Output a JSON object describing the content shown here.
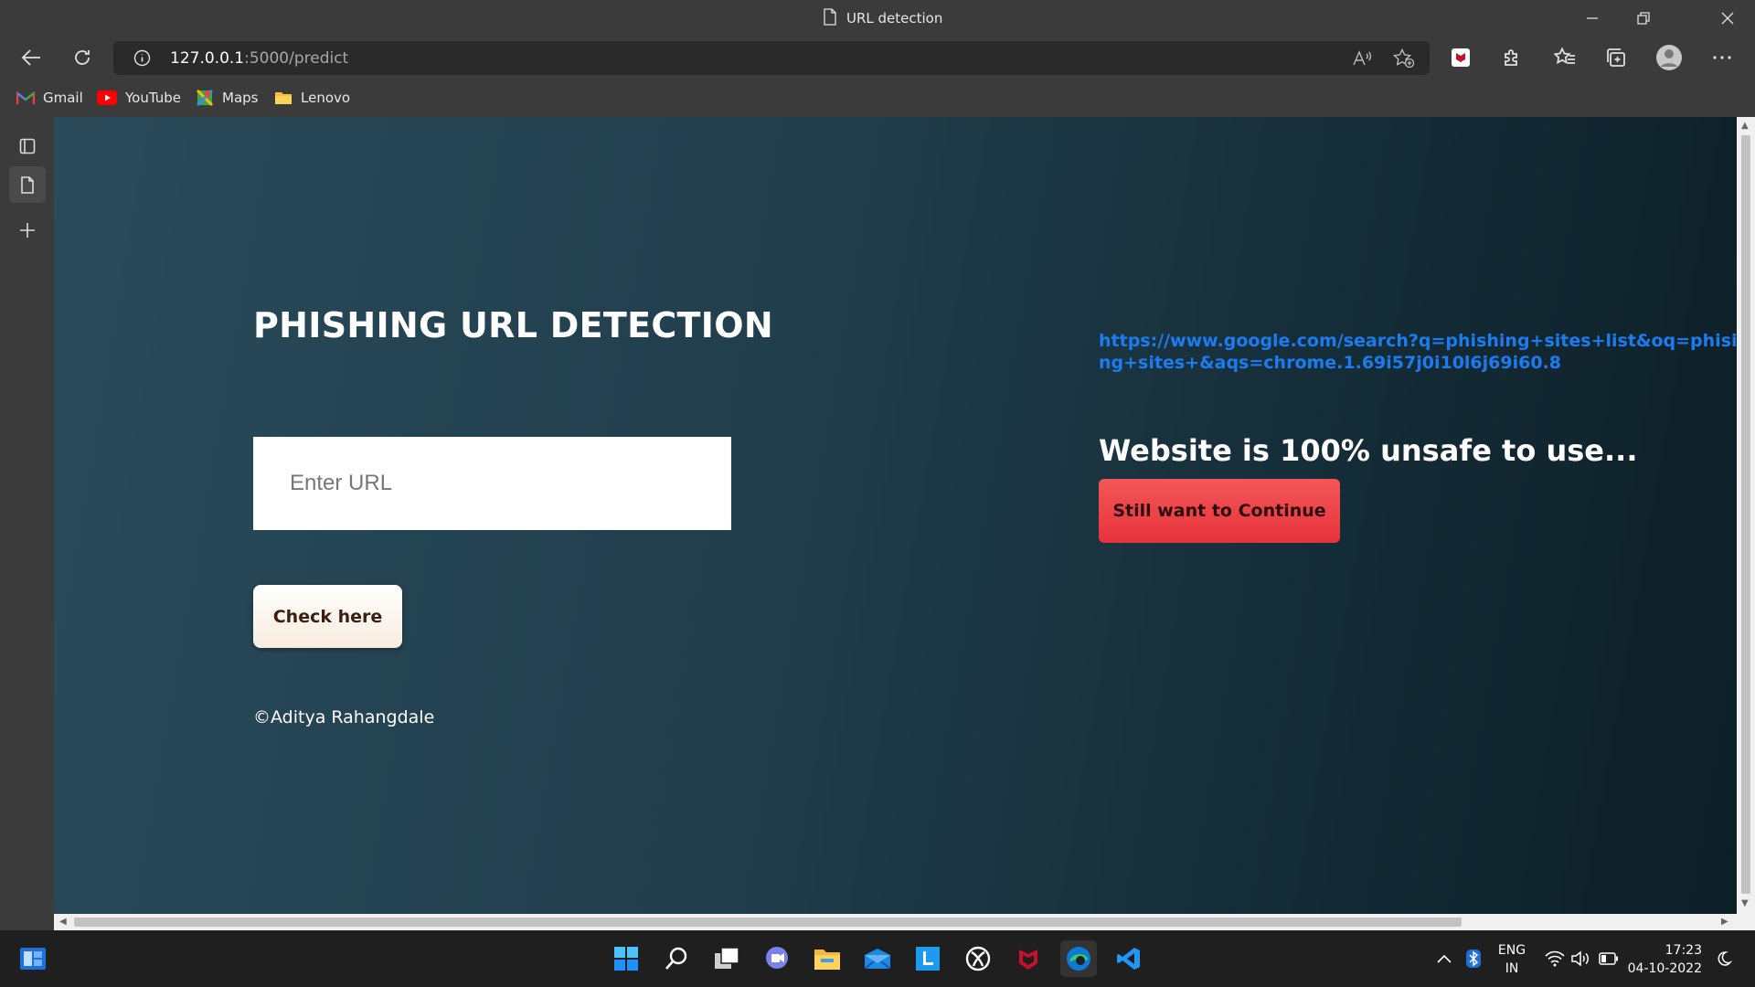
{
  "window": {
    "title": "URL detection"
  },
  "toolbar": {
    "address_host": "127.0.0.1",
    "address_rest": ":5000/predict"
  },
  "bookmarks": [
    {
      "label": "Gmail",
      "icon": "gmail-icon"
    },
    {
      "label": "YouTube",
      "icon": "youtube-icon"
    },
    {
      "label": "Maps",
      "icon": "maps-icon"
    },
    {
      "label": "Lenovo",
      "icon": "folder-icon"
    }
  ],
  "page": {
    "heading": "PHISHING URL DETECTION",
    "input_placeholder": "Enter URL",
    "check_button": "Check here",
    "copyright": "©Aditya Rahangdale",
    "result_url": "https://www.google.com/search?q=phishing+sites+list&oq=phising+sites+&aqs=chrome.1.69i57j0i10l6j69i60.8",
    "result_message": "Website is 100% unsafe to use...",
    "continue_button": "Still want to Continue"
  },
  "taskbar": {
    "language_line1": "ENG",
    "language_line2": "IN",
    "time": "17:23",
    "date": "04-10-2022"
  },
  "colors": {
    "link": "#1a7cf0",
    "danger_button": "#e8323c",
    "page_bg_start": "#2a4b5b",
    "page_bg_end": "#0d1e26"
  }
}
